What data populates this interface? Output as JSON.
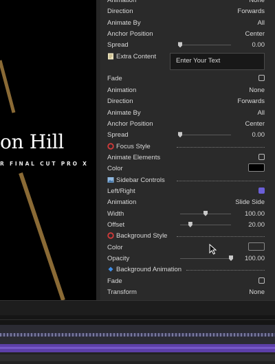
{
  "viewer": {
    "title": "on Hill",
    "subtitle": "R FINAL CUT PRO X",
    "stripe_color": "#8a6a35"
  },
  "inspector": {
    "rows": [
      {
        "kind": "value",
        "label": "Animation",
        "value": "None"
      },
      {
        "kind": "value",
        "label": "Direction",
        "value": "Forwards"
      },
      {
        "kind": "value",
        "label": "Animate By",
        "value": "All"
      },
      {
        "kind": "value",
        "label": "Anchor Position",
        "value": "Center"
      },
      {
        "kind": "slider",
        "label": "Spread",
        "value": "0.00",
        "level": 0.0
      },
      {
        "kind": "header",
        "label": "Extra Content",
        "icon": "note-icon"
      },
      {
        "kind": "spacer"
      },
      {
        "kind": "checkbox",
        "label": "Fade",
        "checked": false
      },
      {
        "kind": "value",
        "label": "Animation",
        "value": "None"
      },
      {
        "kind": "value",
        "label": "Direction",
        "value": "Forwards"
      },
      {
        "kind": "value",
        "label": "Animate By",
        "value": "All"
      },
      {
        "kind": "value",
        "label": "Anchor Position",
        "value": "Center"
      },
      {
        "kind": "slider",
        "label": "Spread",
        "value": "0.00",
        "level": 0.0
      },
      {
        "kind": "header",
        "label": "Focus Style",
        "icon": "red-circle-icon"
      },
      {
        "kind": "checkbox",
        "label": "Animate Elements",
        "checked": false
      },
      {
        "kind": "swatch",
        "label": "Color",
        "color": "#000000"
      },
      {
        "kind": "header",
        "label": "Sidebar Controls",
        "icon": "image-icon"
      },
      {
        "kind": "checkbox",
        "label": "Left/Right",
        "checked": true
      },
      {
        "kind": "value",
        "label": "Animation",
        "value": "Slide Side"
      },
      {
        "kind": "slider",
        "label": "Width",
        "value": "100.00",
        "level": 0.5
      },
      {
        "kind": "slider",
        "label": "Offset",
        "value": "20.00",
        "level": 0.2
      },
      {
        "kind": "header",
        "label": "Background Style",
        "icon": "red-circle-icon"
      },
      {
        "kind": "swatch",
        "label": "Color",
        "color": "#2a2a2a"
      },
      {
        "kind": "slider",
        "label": "Opacity",
        "value": "100.00",
        "level": 1.0
      },
      {
        "kind": "header",
        "label": "Background Animation",
        "icon": "blue-diamond-icon"
      },
      {
        "kind": "checkbox",
        "label": "Fade",
        "checked": false
      },
      {
        "kind": "value",
        "label": "Transform",
        "value": "None"
      }
    ],
    "extra_text_placeholder": "Enter Your Text"
  },
  "colors": {
    "accent": "#6b5fd8",
    "panel": "#2a2a2a",
    "timeline_purple": "#5c3fa8"
  }
}
